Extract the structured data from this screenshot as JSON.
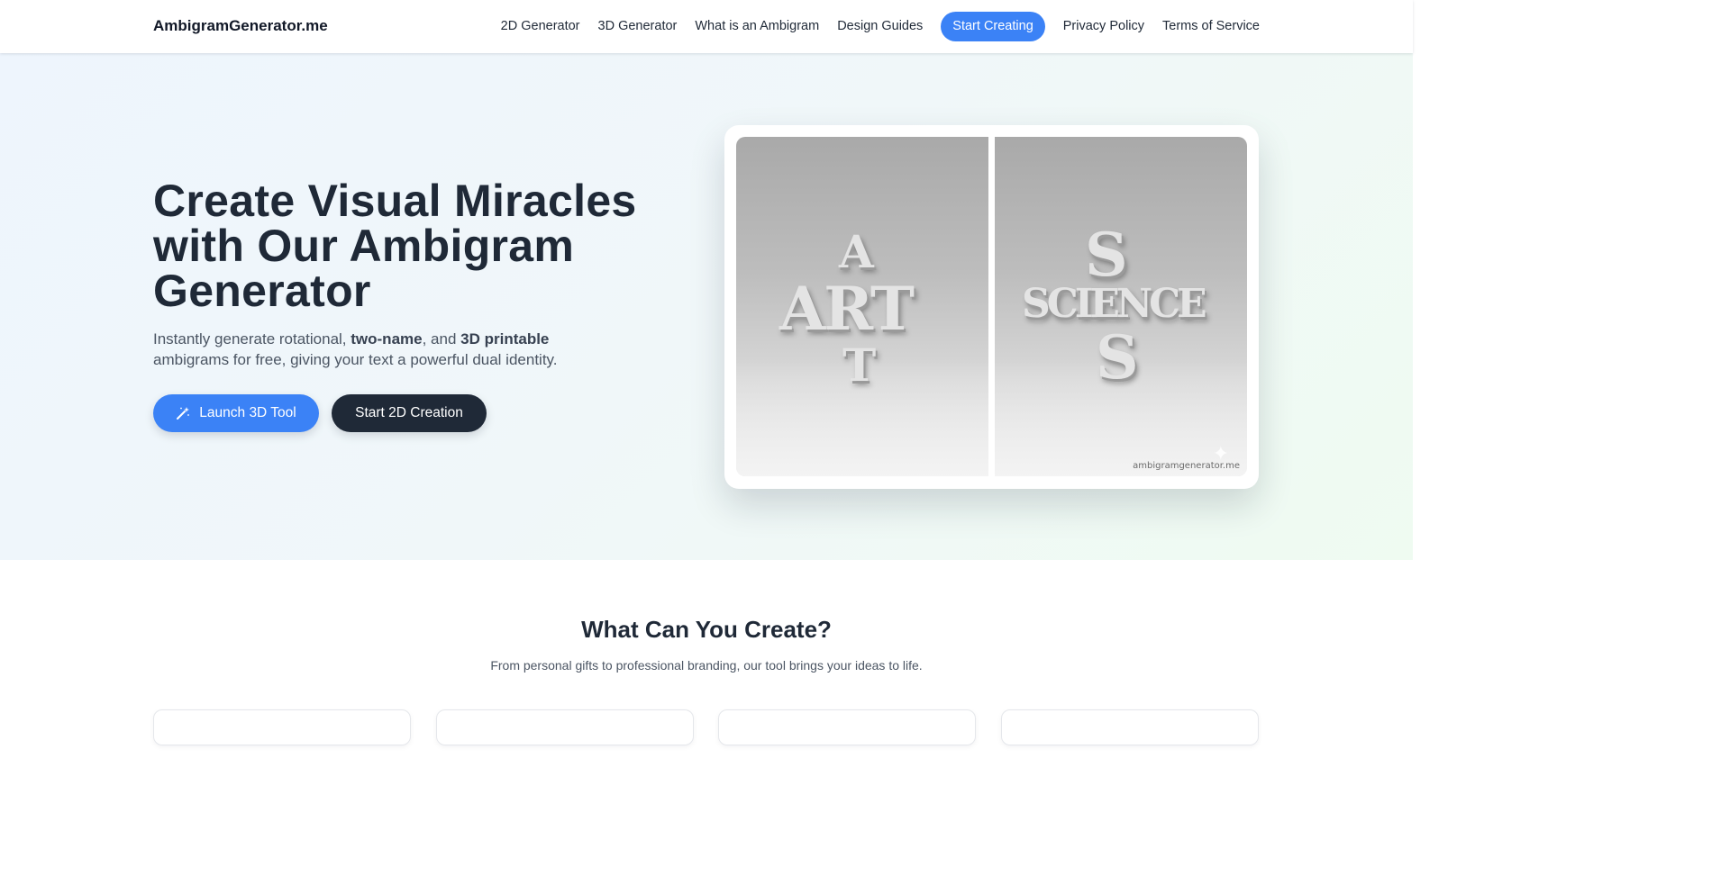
{
  "nav": {
    "brand": "AmbigramGenerator.me",
    "links": [
      "2D Generator",
      "3D Generator",
      "What is an Ambigram",
      "Design Guides"
    ],
    "cta": "Start Creating",
    "secondary_links": [
      "Privacy Policy",
      "Terms of Service"
    ]
  },
  "hero": {
    "title": "Create Visual Miracles with Our Ambigram Generator",
    "subtitle": {
      "part1": "Instantly generate rotational, ",
      "bold1": "two-name",
      "part2": ", and ",
      "bold2": "3D printable",
      "part3": " ambigrams for free, giving your text a powerful dual identity."
    },
    "primary_button": "Launch 3D Tool",
    "secondary_button": "Start 2D Creation",
    "image": {
      "left_word": "ART",
      "left_vertical_top": "A",
      "left_vertical_bottom": "T",
      "right_word": "SCIENCE",
      "right_vertical_top": "S",
      "right_vertical_bottom": "S",
      "watermark": "ambigramgenerator.me"
    }
  },
  "features": {
    "title": "What Can You Create?",
    "subtitle": "From personal gifts to professional branding, our tool brings your ideas to life.",
    "card_count_visible": 4
  },
  "colors": {
    "accent": "#3b82f6",
    "dark": "#1f2937",
    "hero_bg_start": "#eef5fd",
    "hero_bg_end": "#effbf1"
  },
  "icons": {
    "primary_button_icon": "magic-wand-icon",
    "image_sparkle": "sparkle-icon"
  }
}
